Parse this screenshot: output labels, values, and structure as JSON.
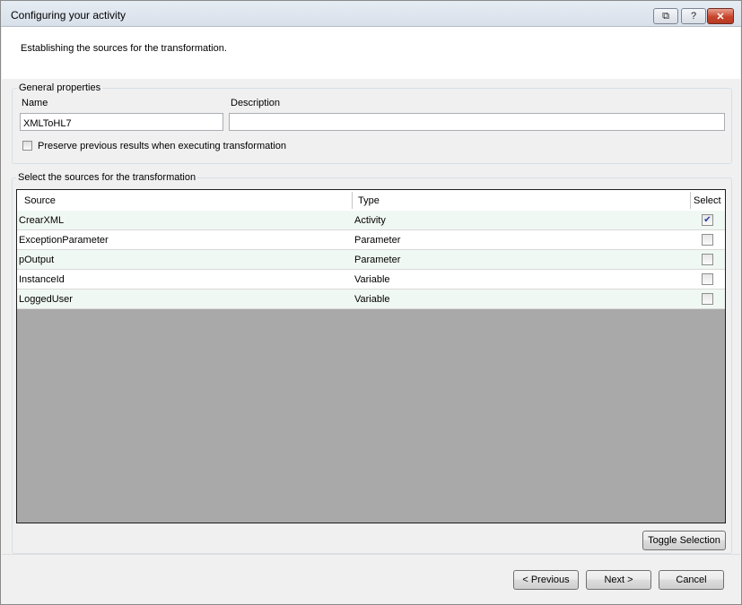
{
  "window": {
    "title": "Configuring your activity",
    "restore_glyph": "⧉",
    "help_glyph": "?",
    "close_glyph": "✕"
  },
  "header": {
    "text": "Establishing the sources for the transformation."
  },
  "general": {
    "group_label": "General properties",
    "name_label": "Name",
    "name_value": "XMLToHL7",
    "description_label": "Description",
    "description_value": "",
    "preserve_label": "Preserve previous results when executing transformation",
    "preserve_checked": false
  },
  "sources": {
    "group_label": "Select the sources for the transformation",
    "columns": [
      "Source",
      "Type",
      "Select"
    ],
    "rows": [
      {
        "source": "CrearXML",
        "type": "Activity",
        "checked": true
      },
      {
        "source": "ExceptionParameter",
        "type": "Parameter",
        "checked": false
      },
      {
        "source": "pOutput",
        "type": "Parameter",
        "checked": false
      },
      {
        "source": "InstanceId",
        "type": "Variable",
        "checked": false
      },
      {
        "source": "LoggedUser",
        "type": "Variable",
        "checked": false
      }
    ]
  },
  "buttons": {
    "toggle_selection": "Toggle Selection",
    "previous": "< Previous",
    "next": "Next >",
    "cancel": "Cancel"
  },
  "colors": {
    "empty_grid": "#a9a9a9",
    "alt_row": "#f0f8f3",
    "check_mark": "#1c3fa0"
  }
}
